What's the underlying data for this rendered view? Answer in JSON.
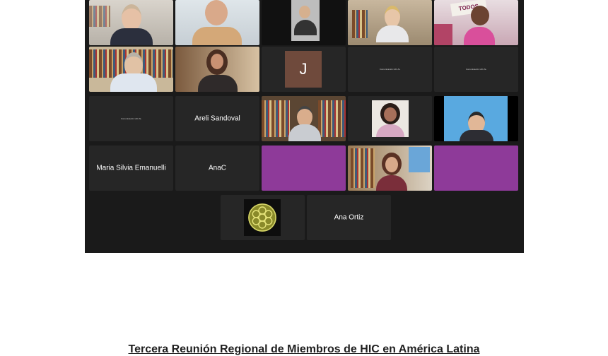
{
  "participants": {
    "row3": [
      "Areli Sandoval"
    ],
    "row4": [
      "Maria Silvia Emanuelli",
      "AnaC"
    ],
    "row5": [
      "Ana Ortiz"
    ],
    "tiny_labels": [
      "Comunicación HIC AL",
      "Comunicación HIC AL",
      "Comunicación HIC AL"
    ],
    "initial_j": "J",
    "poster_text": "TODOS"
  },
  "caption": "Tercera Reunión Regional de Miembros de HIC en América Latina",
  "colors": {
    "window_bg": "#1a1a1a",
    "tile_bg": "#262626",
    "active_speaker": "#7cc242",
    "purple_tile": "#8e3a99",
    "initial_bg": "#6f4a3c"
  }
}
